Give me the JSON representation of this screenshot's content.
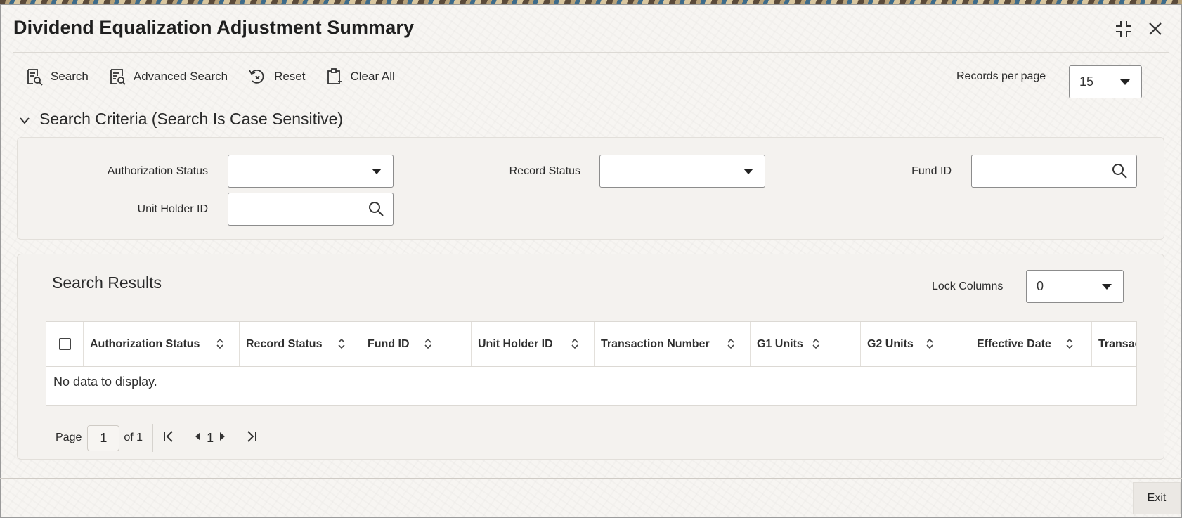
{
  "window": {
    "title": "Dividend Equalization Adjustment Summary"
  },
  "toolbar": {
    "search_label": "Search",
    "advanced_search_label": "Advanced Search",
    "reset_label": "Reset",
    "clear_all_label": "Clear All",
    "records_per_page_label": "Records per page",
    "records_per_page_value": "15"
  },
  "criteria": {
    "header": "Search Criteria (Search Is Case Sensitive)",
    "authorization_status_label": "Authorization Status",
    "authorization_status_value": "",
    "record_status_label": "Record Status",
    "record_status_value": "",
    "fund_id_label": "Fund ID",
    "fund_id_value": "",
    "unit_holder_id_label": "Unit Holder ID",
    "unit_holder_id_value": ""
  },
  "results": {
    "title": "Search Results",
    "lock_columns_label": "Lock Columns",
    "lock_columns_value": "0",
    "columns": [
      "Authorization Status",
      "Record Status",
      "Fund ID",
      "Unit Holder ID",
      "Transaction Number",
      "G1 Units",
      "G2 Units",
      "Effective Date",
      "Transac"
    ],
    "empty_message": "No data to display."
  },
  "pager": {
    "page_label": "Page",
    "page_value": "1",
    "of_label": "of 1",
    "current": "1"
  },
  "footer": {
    "exit_label": "Exit"
  }
}
